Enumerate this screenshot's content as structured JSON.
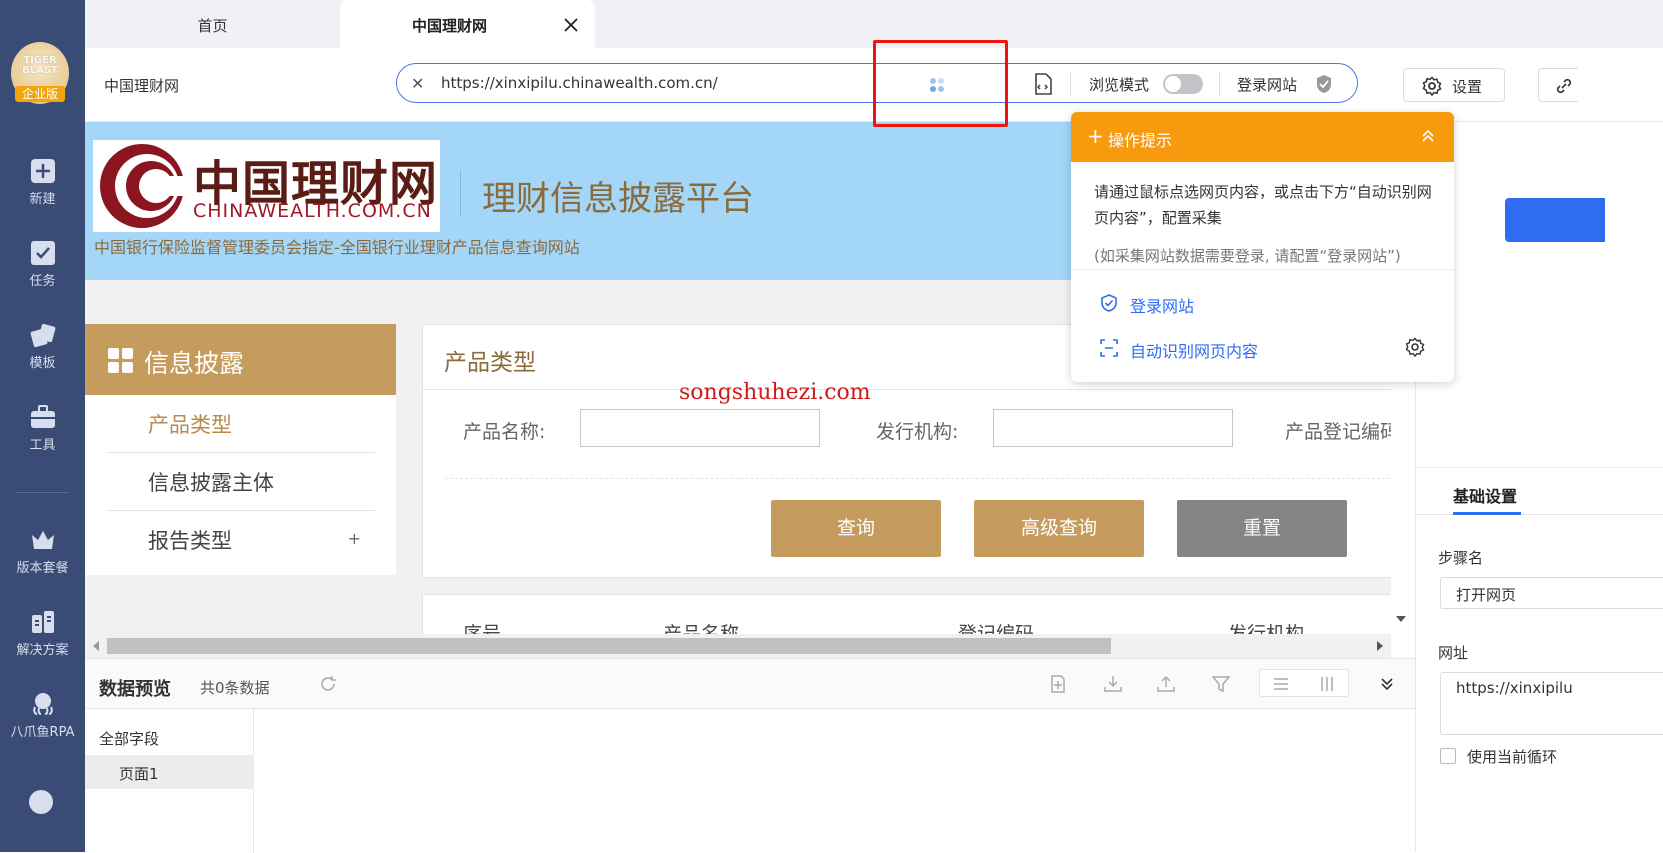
{
  "sidebar": {
    "logo_text": "TIGER BLAST",
    "logo_badge": "企业版",
    "items": [
      {
        "label": "新建",
        "icon": "plus-square-icon"
      },
      {
        "label": "任务",
        "icon": "task-check-icon"
      },
      {
        "label": "模板",
        "icon": "template-icon"
      },
      {
        "label": "工具",
        "icon": "toolbox-icon"
      },
      {
        "label": "版本套餐",
        "icon": "crown-icon"
      },
      {
        "label": "解决方案",
        "icon": "solution-icon"
      },
      {
        "label": "八爪鱼RPA",
        "icon": "octopus-rpa-icon"
      }
    ]
  },
  "tabs": [
    {
      "label": "首页"
    },
    {
      "label": "中国理财网"
    }
  ],
  "addressbar": {
    "site_label": "中国理财网",
    "url": "https://xinxipilu.chinawealth.com.cn/",
    "browse_mode_label": "浏览模式",
    "login_label": "登录网站",
    "settings_label": "设置"
  },
  "webpage": {
    "logo_cn": "中国理财网",
    "logo_en": "CHINAWEALTH.COM.CN",
    "platform_title": "理财信息披露平台",
    "subtitle": "中国银行保险监督管理委员会指定-全国银行业理财产品信息查询网站",
    "menu_title": "信息披露",
    "menu_items": [
      "产品类型",
      "信息披露主体",
      "报告类型"
    ],
    "menu_plus": "+",
    "panel_title": "产品类型",
    "fields": [
      "产品名称:",
      "发行机构:",
      "产品登记编码"
    ],
    "buttons": {
      "query": "查询",
      "advanced": "高级查询",
      "reset": "重置"
    },
    "table_headers": [
      "序号",
      "产品名称",
      "登记编码",
      "发行机构"
    ],
    "watermark": "songshuhezi.com"
  },
  "tip": {
    "title": "操作提示",
    "text": "请通过鼠标点选网页内容，或点击下方“自动识别网页内容”，配置采集",
    "note": "(如采集网站数据需要登录, 请配置“登录网站”)",
    "link_login": "登录网站",
    "link_auto": "自动识别网页内容"
  },
  "preview": {
    "title": "数据预览",
    "count": "共0条数据",
    "all_fields": "全部字段",
    "page": "页面1"
  },
  "right_panel": {
    "tab": "基础设置",
    "step_label": "步骤名",
    "step_value": "打开网页",
    "url_label": "网址",
    "url_value": "https://xinxipilu",
    "checkbox_label": "使用当前循环"
  }
}
